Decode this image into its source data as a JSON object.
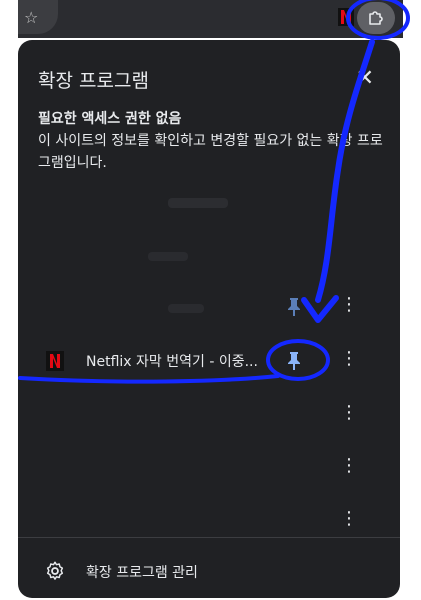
{
  "panel": {
    "title": "확장 프로그램",
    "close_glyph": "✕",
    "section_heading": "필요한 액세스 권한 없음",
    "section_desc": "이 사이트의 정보를 확인하고 변경할 필요가 없는 확장 프로그램입니다."
  },
  "toolbar": {
    "star_glyph": "☆",
    "extensions_icon": "puzzle-piece-icon"
  },
  "extensions": [
    {
      "name": "Netflix 자막 번역기 - 이중...",
      "pinned": true,
      "icon": "netflix-logo-icon"
    }
  ],
  "kebab_glyph": "⋮",
  "footer": {
    "label": "확장 프로그램 관리",
    "icon": "gear-icon"
  },
  "colors": {
    "panel_bg": "#202124",
    "text": "#e8eaed",
    "pin": "#8ab4f8",
    "annotation": "#1428ff",
    "netflix_red": "#e50914"
  }
}
